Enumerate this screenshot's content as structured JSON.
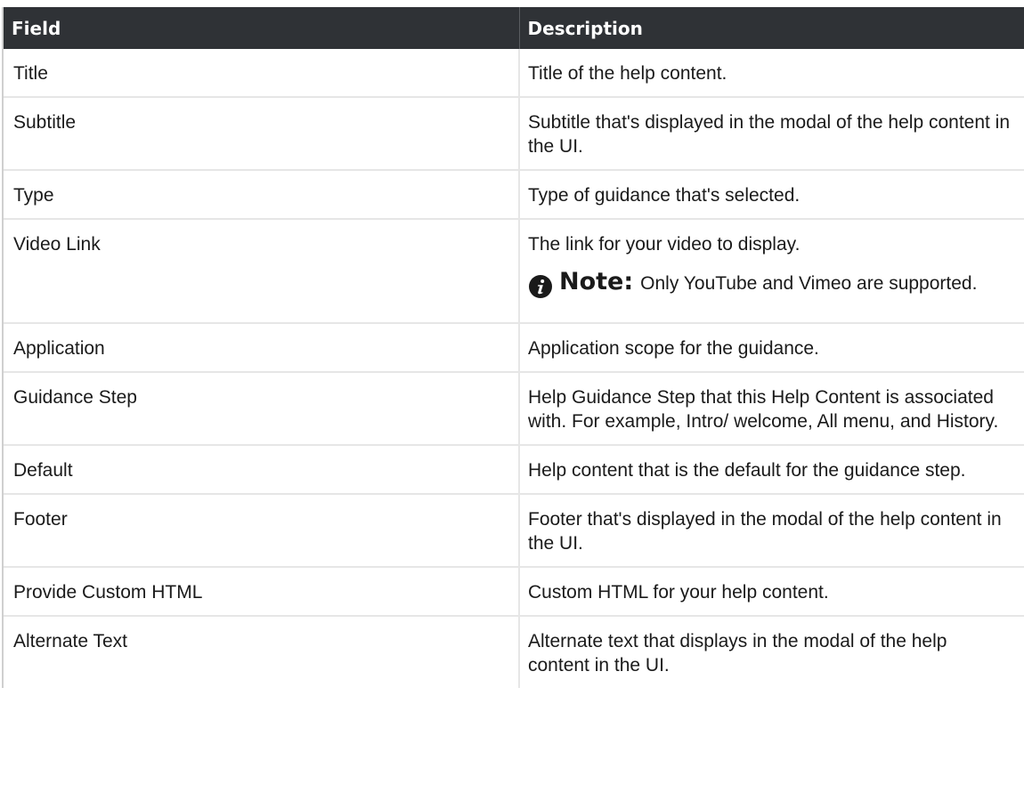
{
  "table": {
    "headers": [
      "Field",
      "Description"
    ],
    "rows": [
      {
        "field": "Title",
        "description": "Title of the help content."
      },
      {
        "field": "Subtitle",
        "description": "Subtitle that's displayed in the modal of the help content in the UI."
      },
      {
        "field": "Type",
        "description": "Type of guidance that's selected."
      },
      {
        "field": "Video Link",
        "description": "The link for your video to display.",
        "note_label": "Note:",
        "note_text": "Only YouTube and Vimeo are supported."
      },
      {
        "field": "Application",
        "description": "Application scope for the guidance."
      },
      {
        "field": "Guidance Step",
        "description": "Help Guidance Step that this Help Content is associated with. For example, Intro/ welcome, All menu, and History."
      },
      {
        "field": "Default",
        "description": "Help content that is the default for the guidance step."
      },
      {
        "field": "Footer",
        "description": "Footer that's displayed in the modal of the help content in the UI."
      },
      {
        "field": "Provide Custom HTML",
        "description": "Custom HTML for your help content."
      },
      {
        "field": "Alternate Text",
        "description": "Alternate text that displays in the modal of the help content in the UI."
      }
    ]
  },
  "icons": {
    "note": "info-icon"
  },
  "colors": {
    "header_bg": "#2f3236",
    "header_text": "#ffffff",
    "row_border": "#e6e6e6",
    "note_icon": "#1a1a1a"
  }
}
